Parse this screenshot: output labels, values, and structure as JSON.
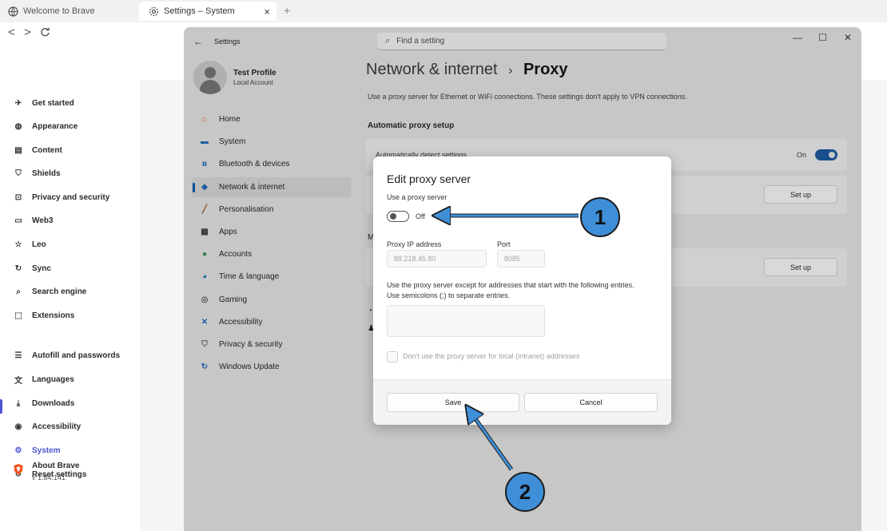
{
  "browser": {
    "tabs": [
      {
        "title": "Welcome to Brave"
      },
      {
        "title": "Settings – System"
      }
    ],
    "new_tab": "+",
    "close_tab": "×",
    "back": "<",
    "forward": ">",
    "reload": "C"
  },
  "brave_sidebar": {
    "items": [
      {
        "label": "Get started",
        "icon": "rocket-icon"
      },
      {
        "label": "Appearance",
        "icon": "palette-icon"
      },
      {
        "label": "Content",
        "icon": "content-icon"
      },
      {
        "label": "Shields",
        "icon": "shield-icon"
      },
      {
        "label": "Privacy and security",
        "icon": "lock-icon"
      },
      {
        "label": "Web3",
        "icon": "wallet-icon"
      },
      {
        "label": "Leo",
        "icon": "leo-icon"
      },
      {
        "label": "Sync",
        "icon": "sync-icon"
      },
      {
        "label": "Search engine",
        "icon": "search-icon"
      },
      {
        "label": "Extensions",
        "icon": "puzzle-icon"
      },
      {
        "label": "Autofill and passwords",
        "icon": "list-icon"
      },
      {
        "label": "Languages",
        "icon": "translate-icon"
      },
      {
        "label": "Downloads",
        "icon": "download-icon"
      },
      {
        "label": "Accessibility",
        "icon": "accessibility-icon"
      },
      {
        "label": "System",
        "icon": "gear-icon",
        "active": true
      },
      {
        "label": "Reset settings",
        "icon": "reset-icon"
      }
    ],
    "about": {
      "title": "About Brave",
      "version": "v 1.84.141"
    },
    "accent_color": "#4c54d2"
  },
  "win_settings": {
    "title": "Settings",
    "search_placeholder": "Find a setting",
    "controls": {
      "minimize": "—",
      "maximize": "☐",
      "close": "✕"
    },
    "profile": {
      "name": "Test Profile",
      "type": "Local Account"
    },
    "nav": [
      {
        "label": "Home",
        "icon": "home-icon"
      },
      {
        "label": "System",
        "icon": "monitor-icon"
      },
      {
        "label": "Bluetooth & devices",
        "icon": "bluetooth-icon"
      },
      {
        "label": "Network & internet",
        "icon": "wifi-icon",
        "selected": true
      },
      {
        "label": "Personalisation",
        "icon": "brush-icon"
      },
      {
        "label": "Apps",
        "icon": "apps-icon"
      },
      {
        "label": "Accounts",
        "icon": "accounts-icon"
      },
      {
        "label": "Time & language",
        "icon": "globe-icon"
      },
      {
        "label": "Gaming",
        "icon": "gamepad-icon"
      },
      {
        "label": "Accessibility",
        "icon": "accessibility-icon"
      },
      {
        "label": "Privacy & security",
        "icon": "shield-icon"
      },
      {
        "label": "Windows Update",
        "icon": "update-icon"
      }
    ],
    "breadcrumb_parent": "Network & internet",
    "breadcrumb_sep": "›",
    "breadcrumb_current": "Proxy",
    "description": "Use a proxy server for Ethernet or WiFi connections. These settings don't apply to VPN connections.",
    "auto_section_title": "Automatic proxy setup",
    "auto_detect_label": "Automatically detect settings",
    "auto_detect_state": "On",
    "setup_button": "Set up",
    "manual_section_initial": "M"
  },
  "dialog": {
    "title": "Edit proxy server",
    "use_proxy_label": "Use a proxy server",
    "use_proxy_state": "Off",
    "ip_label": "Proxy IP address",
    "ip_value": "88.218.45.80",
    "port_label": "Port",
    "port_value": "8085",
    "exceptions_text_1": "Use the proxy server except for addresses that start with the following entries.",
    "exceptions_text_2": "Use semicolons (;) to separate entries.",
    "local_checkbox_label": "Don't use the proxy server for local (intranet) addresses",
    "save_label": "Save",
    "cancel_label": "Cancel"
  },
  "annotations": {
    "step1": "1",
    "step2": "2",
    "color": "#3f8fd8"
  }
}
